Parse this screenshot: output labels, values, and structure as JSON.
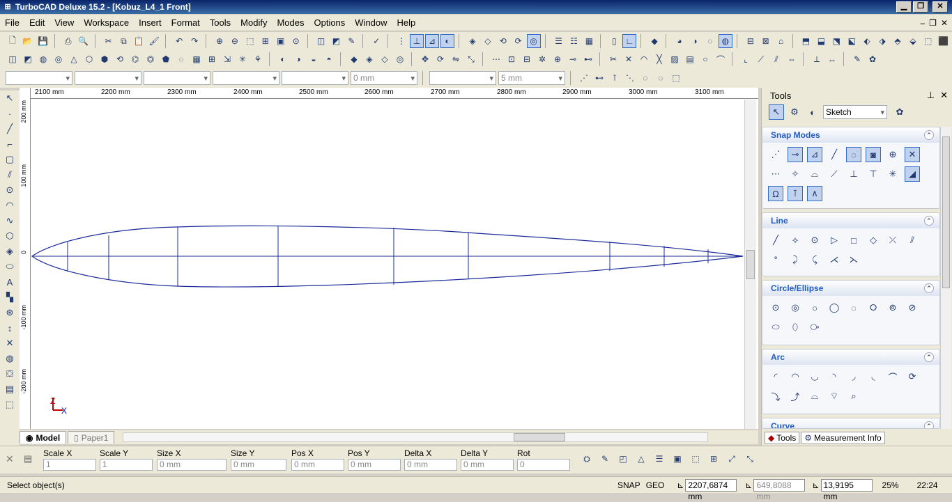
{
  "window": {
    "title": "TurboCAD Deluxe 15.2 - [Kobuz_L4_1 Front]",
    "min_label": "▁",
    "max_label": "❐",
    "close_label": "✕"
  },
  "menu": {
    "items": [
      "File",
      "Edit",
      "View",
      "Workspace",
      "Insert",
      "Format",
      "Tools",
      "Modify",
      "Modes",
      "Options",
      "Window",
      "Help"
    ],
    "mdi_min": "–",
    "mdi_restore": "❐",
    "mdi_close": "✕"
  },
  "property_bar": {
    "field1": "",
    "field2": "",
    "field3": "",
    "field4": "",
    "field5": "",
    "thickness": "0 mm",
    "field7": "",
    "width": "5 mm"
  },
  "ruler": {
    "top_labels": [
      "2100 mm",
      "2200 mm",
      "2300 mm",
      "2400 mm",
      "2500 mm",
      "2600 mm",
      "2700 mm",
      "2800 mm",
      "2900 mm",
      "3000 mm",
      "3100 mm"
    ],
    "left_labels": [
      "200 mm",
      "100 mm",
      "0",
      "-100 mm",
      "-200 mm"
    ]
  },
  "axis_indicator": {
    "z_label": "Z",
    "x_label": "X"
  },
  "tabs": {
    "model": "Model",
    "paper": "Paper1"
  },
  "inspector": {
    "scale_x_label": "Scale X",
    "scale_x_value": "1",
    "scale_y_label": "Scale Y",
    "scale_y_value": "1",
    "size_x_label": "Size X",
    "size_x_value": "0 mm",
    "size_y_label": "Size Y",
    "size_y_value": "0 mm",
    "pos_x_label": "Pos X",
    "pos_x_value": "0 mm",
    "pos_y_label": "Pos Y",
    "pos_y_value": "0 mm",
    "delta_x_label": "Delta X",
    "delta_x_value": "0 mm",
    "delta_y_label": "Delta Y",
    "delta_y_value": "0 mm",
    "rot_label": "Rot",
    "rot_value": "0"
  },
  "status": {
    "prompt": "Select object(s)",
    "snap": "SNAP",
    "geo": "GEO",
    "coord_x": "2207,6874 mm",
    "coord_y": "649,8088 mm",
    "coord_z": "13,9195 mm",
    "zoom": "25%",
    "time": "22:24"
  },
  "panel": {
    "title": "Tools",
    "mode": "Sketch",
    "groups": [
      {
        "title": "Snap Modes"
      },
      {
        "title": "Line"
      },
      {
        "title": "Circle/Ellipse"
      },
      {
        "title": "Arc"
      },
      {
        "title": "Curve"
      }
    ],
    "tab_tools": "Tools",
    "tab_measure": "Measurement Info"
  }
}
